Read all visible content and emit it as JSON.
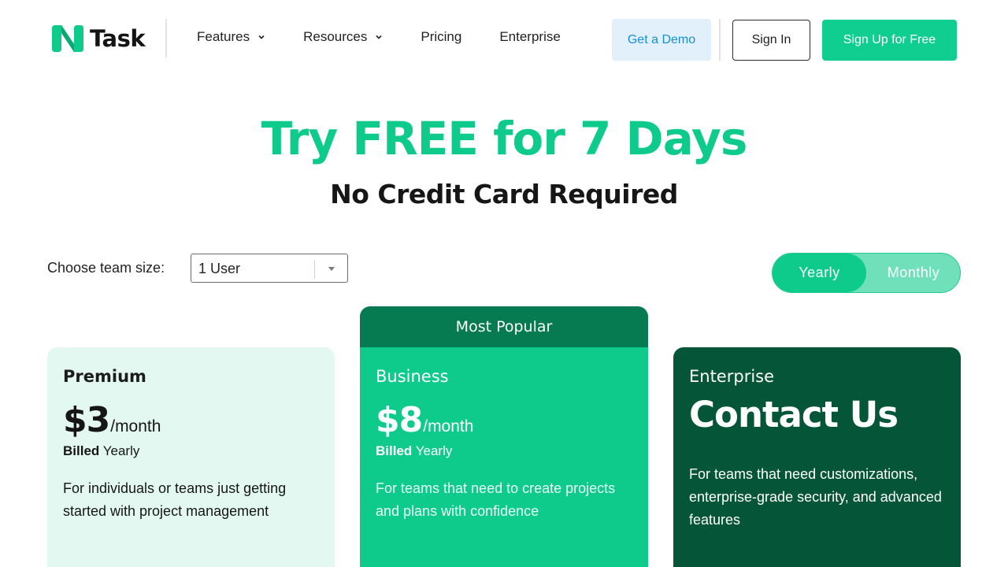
{
  "brand": {
    "name": "Task",
    "accent_color": "#0ecb8b",
    "logo_icon": "ntask-logo-icon"
  },
  "nav": {
    "items": [
      {
        "label": "Features",
        "has_dropdown": true
      },
      {
        "label": "Resources",
        "has_dropdown": true
      },
      {
        "label": "Pricing",
        "has_dropdown": false
      },
      {
        "label": "Enterprise",
        "has_dropdown": false
      }
    ]
  },
  "header_actions": {
    "demo_label": "Get a Demo",
    "signin_label": "Sign In",
    "signup_label": "Sign Up for Free"
  },
  "hero": {
    "title": "Try FREE for 7 Days",
    "subtitle": "No Credit Card Required"
  },
  "controls": {
    "team_size_label": "Choose team size:",
    "team_size_value": "1 User",
    "billing_options": [
      "Yearly",
      "Monthly"
    ],
    "billing_selected": "Yearly"
  },
  "plans": {
    "popular_label": "Most Popular",
    "premium": {
      "name": "Premium",
      "price": "$3",
      "period": "/month",
      "billed_label": "Billed",
      "billed_value": "Yearly",
      "description": "For individuals or teams just getting started with project management"
    },
    "business": {
      "name": "Business",
      "price": "$8",
      "period": "/month",
      "billed_label": "Billed",
      "billed_value": "Yearly",
      "description": "For teams that need to create projects and plans with confidence"
    },
    "enterprise": {
      "name": "Enterprise",
      "heading": "Contact Us",
      "description": "For teams that need customizations, enterprise-grade security, and advanced features"
    }
  }
}
